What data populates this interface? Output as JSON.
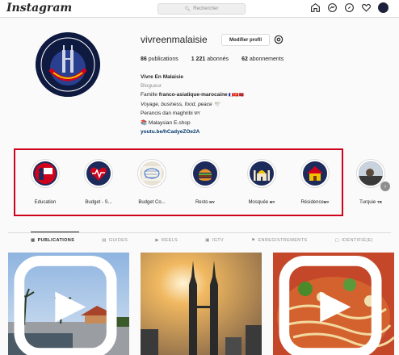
{
  "app": {
    "logo": "Instagram"
  },
  "search": {
    "placeholder": "Rechercher"
  },
  "nav": {
    "icons": [
      "home-icon",
      "messenger-icon",
      "explore-icon",
      "heart-icon",
      "avatar"
    ]
  },
  "profile": {
    "username": "vivreenmalaisie",
    "edit_label": "Modifier profil",
    "stats": {
      "posts_count": "86",
      "posts_label": "publications",
      "followers_count": "1 221",
      "followers_label": "abonnés",
      "following_count": "62",
      "following_label": "abonnements"
    },
    "bio": {
      "name": "Vivre En Malaisie",
      "category": "Blogueur",
      "line1_prefix": "Famille ",
      "line1_bold": "franco-asiatique-marocaine",
      "line1_suffix": " 🇨🇵🇭🇰🇲🇦",
      "line2": "Voyage, business, food, peace 🕊️",
      "line3": "Perancis dan maghribi",
      "line3_tag": "MY",
      "line4": "📚 Malaysian E-shop",
      "link": "youtu.be/hCadyeZOe2A"
    }
  },
  "highlights": [
    {
      "label": "Education",
      "tag": "",
      "bg": "#1d2a5c"
    },
    {
      "label": "Budget - S...",
      "tag": "",
      "bg": "#1d2a5c"
    },
    {
      "label": "Budget Co...",
      "tag": "",
      "bg": "#e8e2d6"
    },
    {
      "label": "Resto",
      "tag": "MY",
      "bg": "#1d2a5c"
    },
    {
      "label": "Mosquée",
      "tag": "MY",
      "bg": "#1d2a5c"
    },
    {
      "label": "Résidence",
      "tag": "MY",
      "bg": "#1d2a5c"
    },
    {
      "label": "Turquie",
      "tag": "TR",
      "bg": "#3a3a3a"
    }
  ],
  "tabs": [
    {
      "label": "PUBLICATIONS",
      "icon": "grid-icon",
      "active": true
    },
    {
      "label": "GUIDES",
      "icon": "guides-icon",
      "active": false
    },
    {
      "label": "REELS",
      "icon": "reels-icon",
      "active": false
    },
    {
      "label": "IGTV",
      "icon": "igtv-icon",
      "active": false
    },
    {
      "label": "ENREGISTREMENTS",
      "icon": "bookmark-icon",
      "active": false
    },
    {
      "label": "IDENTIFIÉ(E)",
      "icon": "tagged-icon",
      "active": false
    }
  ],
  "colors": {
    "highlight_border": "#d0021b",
    "link": "#00376b",
    "muted": "#8e8e8e"
  }
}
